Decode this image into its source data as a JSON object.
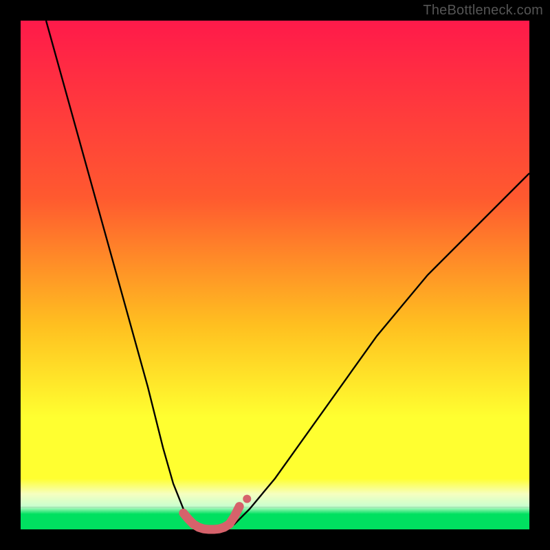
{
  "attribution": "TheBottleneck.com",
  "colors": {
    "black": "#000000",
    "grad_top": "#ff1a4a",
    "grad_upper": "#ff5a2f",
    "grad_mid": "#ffc020",
    "grad_low": "#ffff30",
    "grad_pale": "#f6ffbf",
    "grad_green": "#00e060",
    "curve": "#000000",
    "marker_fill": "#d6626b",
    "marker_stroke": "#d6626b"
  },
  "chart_data": {
    "type": "line",
    "title": "",
    "xlabel": "",
    "ylabel": "",
    "xlim": [
      0,
      100
    ],
    "ylim": [
      0,
      100
    ],
    "series": [
      {
        "name": "bottleneck-curve",
        "x": [
          5,
          10,
          15,
          20,
          25,
          28,
          30,
          32,
          34,
          36,
          38,
          40,
          42,
          45,
          50,
          55,
          60,
          65,
          70,
          75,
          80,
          85,
          90,
          95,
          100
        ],
        "values": [
          100,
          82,
          64,
          46,
          28,
          16,
          9,
          4,
          1,
          0,
          0,
          0,
          1,
          4,
          10,
          17,
          24,
          31,
          38,
          44,
          50,
          55,
          60,
          65,
          70
        ]
      }
    ],
    "markers": {
      "name": "optimal-range",
      "x": [
        32,
        33,
        34,
        35,
        36,
        37,
        38,
        39,
        40,
        41,
        42,
        43
      ],
      "values": [
        3.2,
        2.0,
        1.0,
        0.4,
        0.1,
        0,
        0,
        0.1,
        0.4,
        1.0,
        2.5,
        4.5
      ],
      "end_dot": {
        "x": 44.5,
        "value": 6.0
      }
    },
    "gradient_stops_pct": [
      0,
      35,
      60,
      78,
      90,
      94,
      96,
      100
    ]
  }
}
